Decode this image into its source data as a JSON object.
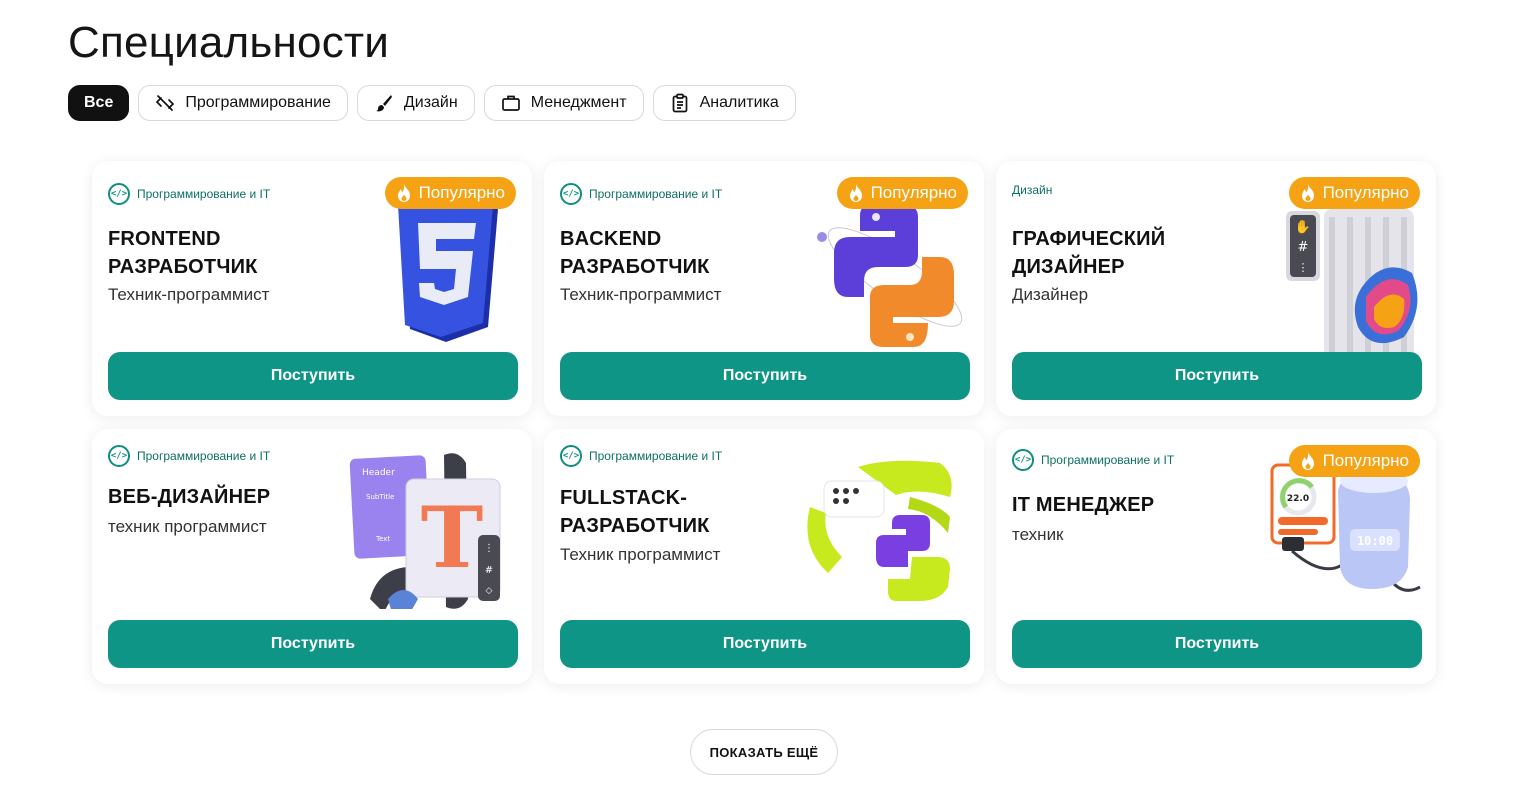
{
  "page": {
    "title": "Специальности"
  },
  "filters": [
    {
      "label": "Все",
      "icon": "none",
      "active": true
    },
    {
      "label": "Программирование",
      "icon": "code-slash-icon",
      "active": false
    },
    {
      "label": "Дизайн",
      "icon": "brush-icon",
      "active": false
    },
    {
      "label": "Менеджмент",
      "icon": "briefcase-icon",
      "active": false
    },
    {
      "label": "Аналитика",
      "icon": "clipboard-icon",
      "active": false
    }
  ],
  "cards": [
    {
      "category": "Программирование и IT",
      "badge": "Популярно",
      "title": "FRONTEND РАЗРАБОТЧИК",
      "subtitle": "Техник-программист",
      "button": "Поступить",
      "art": "css3-logo"
    },
    {
      "category": "Программирование и IT",
      "badge": "Популярно",
      "title": "BACKEND РАЗРАБОТЧИК",
      "subtitle": "Техник-программист",
      "button": "Поступить",
      "art": "python-logo"
    },
    {
      "category": "Дизайн",
      "badge": "Популярно",
      "title": "ГРАФИЧЕСКИЙ ДИЗАЙНЕР",
      "subtitle": "Дизайнер",
      "button": "Поступить",
      "art": "design-panel"
    },
    {
      "category": "Программирование и IT",
      "badge": "",
      "title": "ВЕБ-ДИЗАЙНЕР",
      "subtitle": "техник программист",
      "button": "Поступить",
      "art": "typography"
    },
    {
      "category": "Программирование и IT",
      "badge": "",
      "title": "FULLSTACK-РАЗРАБОТЧИК",
      "subtitle": "Техник программист",
      "button": "Поступить",
      "art": "fullstack"
    },
    {
      "category": "Программирование и IT",
      "badge": "Популярно",
      "title": "IT МЕНЕДЖЕР",
      "subtitle": "техник",
      "button": "Поступить",
      "art": "smart-home"
    }
  ],
  "art_text": {
    "typo_header": "Header",
    "typo_subtitle": "SubTitle",
    "typo_text": "Text",
    "typo_letter": "T",
    "thermo_value": "22.0",
    "clock_value": "10:00"
  },
  "show_more": "ПОКАЗАТЬ ЕЩЁ",
  "colors": {
    "accent": "#0f9585",
    "badge": "#f5a314",
    "active_chip": "#111111"
  }
}
